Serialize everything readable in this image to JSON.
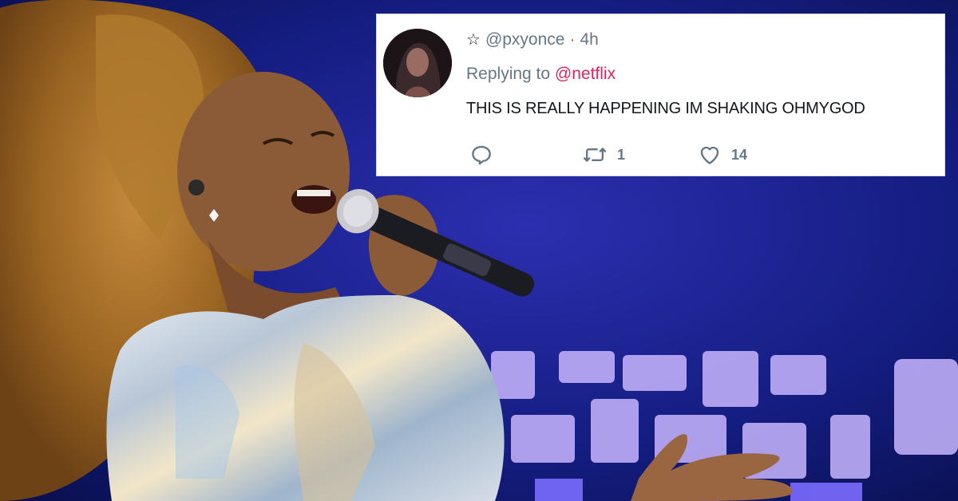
{
  "tweet": {
    "username": "@pxyonce",
    "separator": "·",
    "time": "4h",
    "replying_prefix": "Replying to",
    "replying_to": "@netflix",
    "text": "THIS IS REALLY HAPPENING IM SHAKING OHMYGOD",
    "retweet_count": "1",
    "like_count": "14"
  },
  "icons": {
    "badge": "star-icon",
    "reply": "reply-icon",
    "retweet": "retweet-icon",
    "like": "heart-icon"
  },
  "colors": {
    "mention": "#e0245e",
    "secondary_text": "#657786",
    "background_stage": "#101a6b"
  }
}
